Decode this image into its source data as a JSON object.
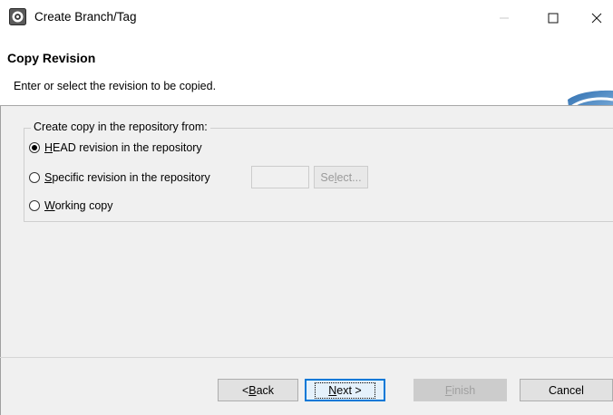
{
  "window": {
    "title": "Create Branch/Tag",
    "icons": {
      "app": "eclipse-gear-icon",
      "minimize": "minimize-icon",
      "maximize": "maximize-icon",
      "close": "close-icon"
    }
  },
  "header": {
    "title": "Copy Revision",
    "description": "Enter or select the revision to be copied.",
    "banner_icon": "subversive-logo-icon"
  },
  "copy_from": {
    "legend": "Create copy in the repository from:",
    "options": [
      {
        "key": "H",
        "rest": "EAD revision in the repository",
        "checked": true
      },
      {
        "key": "S",
        "rest": "pecific revision in the repository",
        "checked": false
      },
      {
        "key": "W",
        "rest": "orking copy",
        "checked": false
      }
    ],
    "revision_value": "",
    "select_button": {
      "pre": "Se",
      "key": "l",
      "post": "ect...",
      "enabled": false
    }
  },
  "buttons": {
    "back": {
      "pre": "< ",
      "key": "B",
      "post": "ack"
    },
    "next": {
      "pre": "",
      "key": "N",
      "post": "ext >"
    },
    "finish": {
      "pre": "",
      "key": "F",
      "post": "inish",
      "enabled": false
    },
    "cancel": {
      "label": "Cancel"
    }
  },
  "colors": {
    "focus_border": "#0078d7",
    "dialog_bg": "#f0f0f0"
  }
}
